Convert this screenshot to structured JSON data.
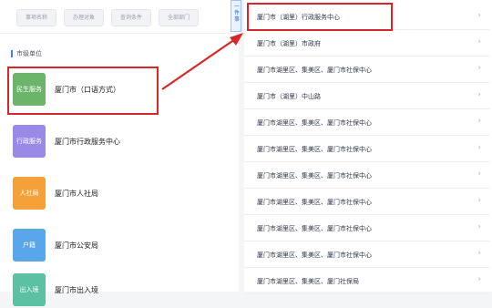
{
  "filters": [
    "事项名称",
    "办理对象",
    "查询条件",
    "全部部门"
  ],
  "divider_label": "一件事",
  "section_title": "市级单位",
  "left_items": [
    {
      "badge": "民生服务",
      "label": "厦门市（口语方式）",
      "color": "#6bb46a"
    },
    {
      "badge": "行政服务",
      "label": "厦门市行政服务中心",
      "color": "#9b89e8"
    },
    {
      "badge": "人社局",
      "label": "厦门市人社局",
      "color": "#f5a13a"
    },
    {
      "badge": "户籍",
      "label": "厦门市公安局",
      "color": "#5aa6ea"
    },
    {
      "badge": "出入境",
      "label": "厦门市出入境",
      "color": "#5cc1a2"
    }
  ],
  "right_rows": [
    "厦门市（湖里）行政服务中心",
    "厦门市（湖里）市政府",
    "厦门市湖里区、集美区、厦门市社保中心",
    "厦门市（湖里）中山路",
    "厦门市湖里区、集美区、厦门市社保中心",
    "厦门市湖里区、集美区、厦门市社保中心",
    "厦门市湖里区、集美区、厦门市社保中心",
    "厦门市湖里区、集美区、厦门市社保中心",
    "厦门市湖里区、集美区、厦门市社保中心",
    "厦门市湖里区、集美区、厦门市社保中心",
    "厦门市湖里区、集美区、厦门社保局"
  ],
  "colors": {
    "highlight": "#d62828",
    "accent": "#3c82f6"
  }
}
